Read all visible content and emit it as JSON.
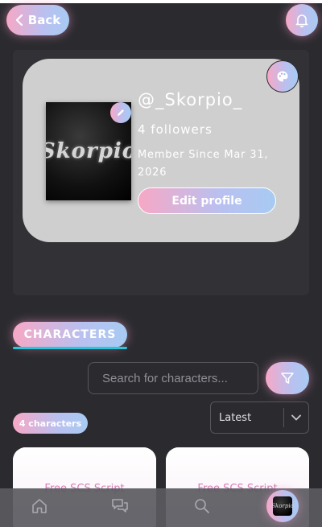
{
  "header": {
    "back_label": "Back",
    "back_icon": "chevron-left-icon",
    "bell_icon": "bell-icon"
  },
  "profile": {
    "username": "@_Skorpio_",
    "followers": "4 followers",
    "member_since": "Member Since Mar 31, 2026",
    "edit_profile_label": "Edit profile",
    "avatar_text": "Skorpio",
    "palette_icon": "palette-icon",
    "edit_avatar_icon": "pencil-icon"
  },
  "characters": {
    "tab_label": "CHARACTERS",
    "search_placeholder": "Search for characters...",
    "filter_icon": "filter-icon",
    "count_label": "4 characters",
    "sort_value": "Latest",
    "cards": [
      {
        "text": "Free SCS Script"
      },
      {
        "text": "Free SCS Script"
      }
    ]
  },
  "nav": {
    "items": [
      "home-icon",
      "chat-icon",
      "search-icon",
      "profile-avatar"
    ]
  },
  "colors": {
    "background": "#2b2b2f",
    "accent_pink": "#f7a8c6",
    "accent_blue": "#a7cbf2",
    "tab_underline": "#2bc4d8",
    "card": "#cfcfcf"
  }
}
